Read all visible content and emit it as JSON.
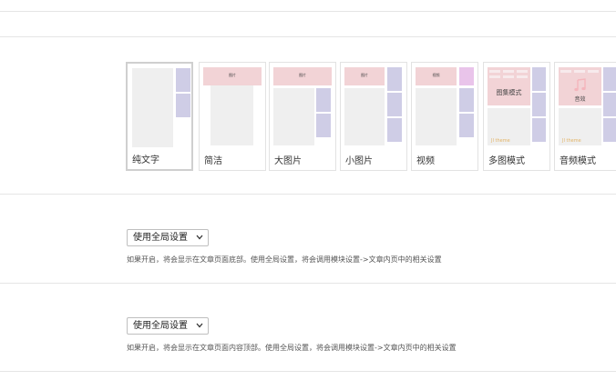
{
  "layout_options": [
    {
      "id": "text",
      "label": "纯文字",
      "selected": true
    },
    {
      "id": "simple",
      "label": "简洁",
      "badge": "图片"
    },
    {
      "id": "large",
      "label": "大图片",
      "badge": "图片"
    },
    {
      "id": "small",
      "label": "小图片",
      "badge": "图片"
    },
    {
      "id": "video",
      "label": "视频",
      "badge": "视频"
    },
    {
      "id": "gallery",
      "label": "多图模式",
      "center_text": "图集模式",
      "watermark": "JI theme"
    },
    {
      "id": "audio",
      "label": "音频模式",
      "center_text": "音效",
      "icon": "music-note-icon",
      "watermark": "JI theme"
    }
  ],
  "setting_bottom": {
    "select_value": "使用全局设置",
    "help": "如果开启，将会显示在文章页面底部。使用全局设置，将会调用模块设置->文章内页中的相关设置"
  },
  "setting_top": {
    "select_value": "使用全局设置",
    "help": "如果开启，将会显示在文章页面内容顶部。使用全局设置，将会调用模块设置->文章内页中的相关设置"
  },
  "colors": {
    "purple": "#cfcde6",
    "pink": "#f2d3d6",
    "gray": "#efefef",
    "violet": "#e9c4ea",
    "divider": "#e5e5e5"
  }
}
